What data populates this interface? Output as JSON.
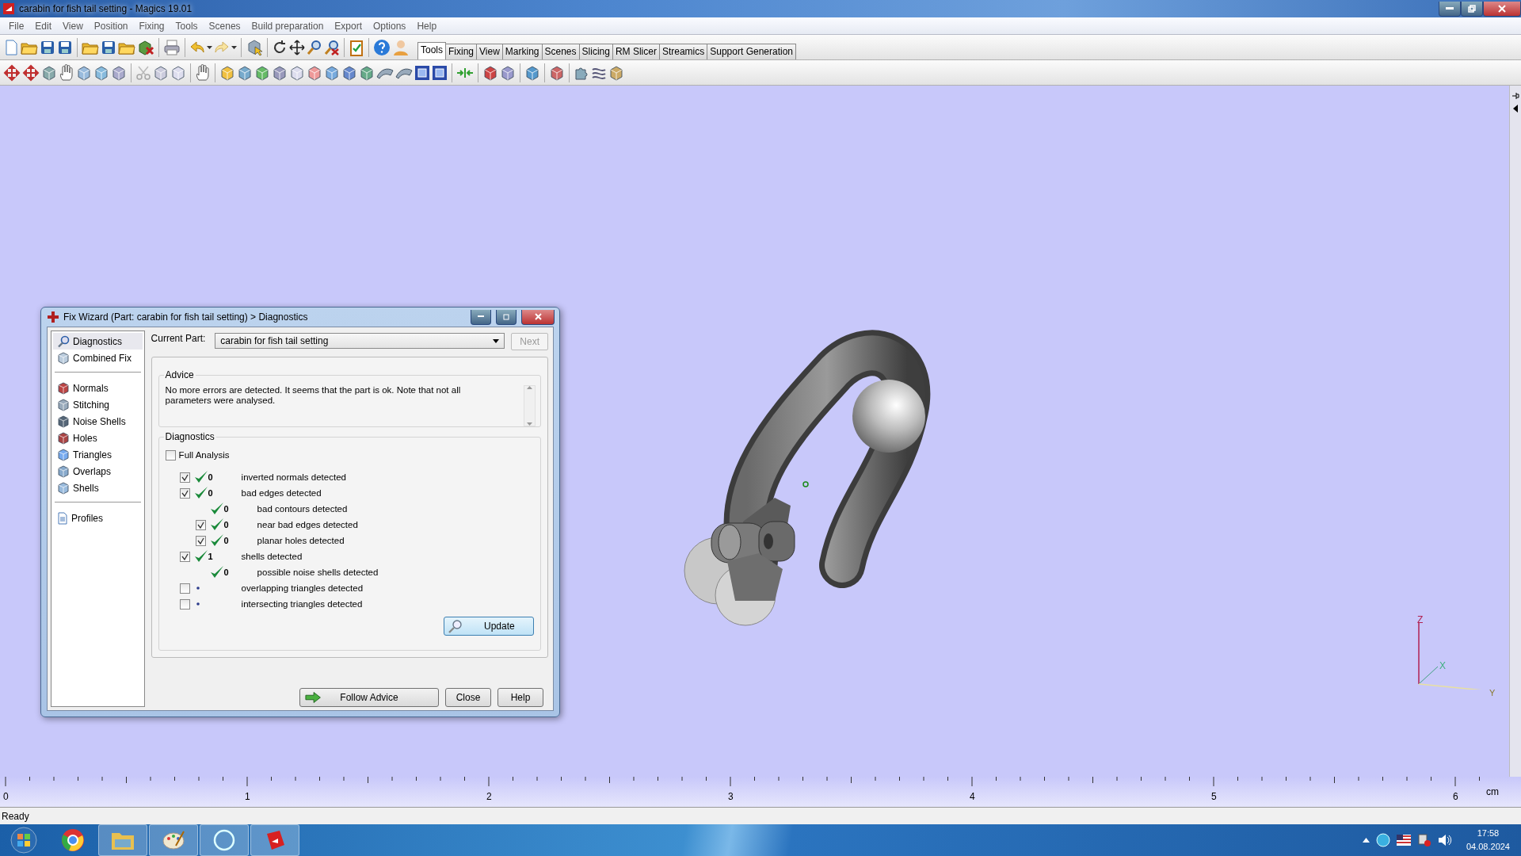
{
  "window": {
    "title": "carabin for fish tail setting - Magics 19.01"
  },
  "menu": [
    "File",
    "Edit",
    "View",
    "Position",
    "Fixing",
    "Tools",
    "Scenes",
    "Build preparation",
    "Export",
    "Options",
    "Help"
  ],
  "toolbar_tabs": [
    {
      "label": "Tools",
      "selected": true
    },
    {
      "label": "Fixing",
      "selected": false
    },
    {
      "label": "View",
      "selected": false
    },
    {
      "label": "Marking",
      "selected": false
    },
    {
      "label": "Scenes",
      "selected": false
    },
    {
      "label": "Slicing",
      "selected": false
    },
    {
      "label": "RM Slicer",
      "selected": false
    },
    {
      "label": "Streamics",
      "selected": false
    },
    {
      "label": "Support Generation",
      "selected": false
    }
  ],
  "fix_wizard": {
    "title": "Fix Wizard (Part: carabin for fish tail setting) > Diagnostics",
    "nav_groups": [
      [
        {
          "label": "Diagnostics",
          "selected": true
        },
        {
          "label": "Combined Fix",
          "selected": false
        }
      ],
      [
        {
          "label": "Normals",
          "selected": false
        },
        {
          "label": "Stitching",
          "selected": false
        },
        {
          "label": "Noise Shells",
          "selected": false
        },
        {
          "label": "Holes",
          "selected": false
        },
        {
          "label": "Triangles",
          "selected": false
        },
        {
          "label": "Overlaps",
          "selected": false
        },
        {
          "label": "Shells",
          "selected": false
        }
      ],
      [
        {
          "label": "Profiles",
          "selected": false
        }
      ]
    ],
    "current_part_label": "Current Part:",
    "current_part": "carabin for fish tail setting",
    "next_button": {
      "label": "Next",
      "disabled": true
    },
    "advice": {
      "title": "Advice",
      "text": "No more errors are detected. It seems that the part is ok. Note that not all parameters were analysed."
    },
    "diagnostics": {
      "title": "Diagnostics",
      "full_analysis": {
        "label": "Full Analysis",
        "checked": false
      },
      "checks": [
        {
          "kind": "checkable",
          "checked": true,
          "ok": true,
          "count": "0",
          "label": "inverted normals detected"
        },
        {
          "kind": "checkable",
          "checked": true,
          "ok": true,
          "count": "0",
          "label": "bad edges detected",
          "children": [
            {
              "kind": "info",
              "ok": true,
              "count": "0",
              "label": "bad contours detected"
            },
            {
              "kind": "checkable",
              "checked": true,
              "ok": true,
              "count": "0",
              "label": "near bad edges detected"
            },
            {
              "kind": "checkable",
              "checked": true,
              "ok": true,
              "count": "0",
              "label": "planar holes detected"
            }
          ]
        },
        {
          "kind": "checkable",
          "checked": true,
          "ok": true,
          "count": "1",
          "label": "shells detected",
          "children": [
            {
              "kind": "info",
              "ok": true,
              "count": "0",
              "label": "possible noise shells detected"
            }
          ]
        },
        {
          "kind": "checkable",
          "checked": false,
          "ok": false,
          "label": "overlapping triangles detected"
        },
        {
          "kind": "checkable",
          "checked": false,
          "ok": false,
          "label": "intersecting triangles detected"
        }
      ]
    },
    "update_button": "Update",
    "buttons": [
      "Follow Advice",
      "Close",
      "Help"
    ]
  },
  "viewport": {
    "axes": [
      "Z",
      "X",
      "Y"
    ]
  },
  "ruler": {
    "labels": [
      "0",
      "1",
      "2",
      "3",
      "4",
      "5",
      "6"
    ],
    "unit": "cm"
  },
  "status_bar": "Ready",
  "taskbar": {
    "time": "17:58",
    "date": "04.08.2024"
  }
}
